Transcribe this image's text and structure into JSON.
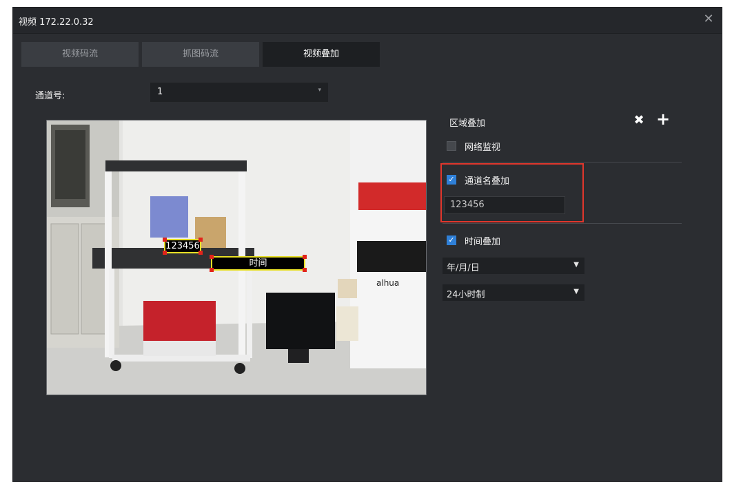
{
  "window": {
    "title": "视频 172.22.0.32",
    "close_icon": "close-icon"
  },
  "tabs": [
    {
      "label": "视频码流",
      "active": false
    },
    {
      "label": "抓图码流",
      "active": false
    },
    {
      "label": "视频叠加",
      "active": true
    }
  ],
  "channel": {
    "label": "通道号:",
    "value": "1"
  },
  "preview": {
    "osd_channel_name": "123456",
    "osd_time": "时间",
    "brand_logo": "alhua"
  },
  "overlay_panel": {
    "area_label": "区域叠加",
    "delete_icon": "close-x-icon",
    "add_icon": "plus-icon",
    "network_monitor": {
      "label": "网络监视",
      "checked": false
    },
    "channel_name": {
      "label": "通道名叠加",
      "checked": true,
      "value": "123456"
    },
    "time": {
      "label": "时间叠加",
      "checked": true
    },
    "date_format": {
      "value": "年/月/日"
    },
    "hour_format": {
      "value": "24小时制"
    }
  },
  "colors": {
    "accent": "#2f80d8",
    "highlight_box": "#e1362c",
    "osd_border": "#e8e025",
    "osd_handle": "#e2241b"
  }
}
